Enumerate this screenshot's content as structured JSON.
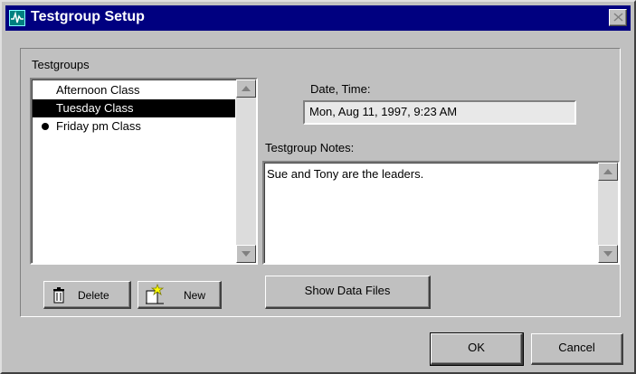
{
  "window": {
    "title": "Testgroup Setup"
  },
  "testgroups": {
    "label": "Testgroups",
    "items": [
      {
        "label": "Afternoon Class",
        "selected": false,
        "active": false
      },
      {
        "label": "Tuesday Class",
        "selected": true,
        "active": false
      },
      {
        "label": "Friday pm Class",
        "selected": false,
        "active": true
      }
    ]
  },
  "date_time": {
    "label": "Date, Time:",
    "value": "Mon, Aug 11, 1997, 9:23 AM"
  },
  "notes": {
    "label": "Testgroup Notes:",
    "value": "Sue and Tony are the leaders."
  },
  "buttons": {
    "delete": "Delete",
    "new": "New",
    "show_data_files": "Show Data Files",
    "ok": "OK",
    "cancel": "Cancel"
  },
  "icons": {
    "app": "waveform-icon",
    "close": "close-icon",
    "delete": "trash-can-icon",
    "new": "new-document-icon"
  }
}
